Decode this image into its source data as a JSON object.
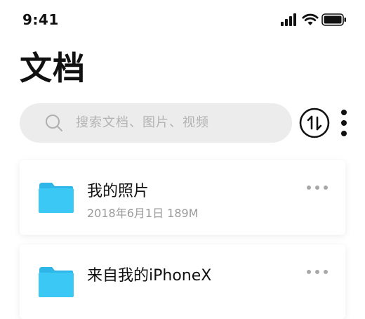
{
  "status_bar": {
    "time": "9:41",
    "icons": [
      "cellular-signal-icon",
      "wifi-icon",
      "battery-icon"
    ]
  },
  "page": {
    "title": "文档"
  },
  "search": {
    "placeholder": "搜索文档、图片、视频"
  },
  "toolbar": {
    "sort_icon": "sort-up-down-icon",
    "more_icon": "vertical-ellipsis-icon"
  },
  "files": [
    {
      "name": "我的照片",
      "meta": "2018年6月1日 189M",
      "icon": "folder-icon"
    },
    {
      "name": "来自我的iPhoneX",
      "meta": "",
      "icon": "folder-icon"
    }
  ],
  "colors": {
    "folder": "#3cc8f5",
    "search_bg": "#ececec",
    "text_secondary": "#9a9a9a"
  }
}
